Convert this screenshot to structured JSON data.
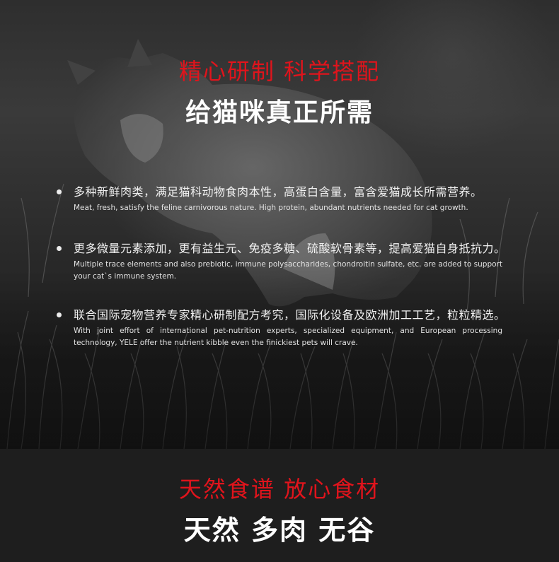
{
  "hero": {
    "headline_red": "精心研制 科学搭配",
    "headline_white": "给猫咪真正所需",
    "features": [
      {
        "zh": "多种新鲜肉类，满足猫科动物食肉本性，高蛋白含量，富含爱猫成长所需营养。",
        "en": "Meat, fresh, satisfy the feline carnivorous nature. High protein, abundant nutrients needed for cat growth."
      },
      {
        "zh": "更多微量元素添加，更有益生元、免疫多糖、硫酸软骨素等，提高爱猫自身抵抗力。",
        "en": "Multiple trace elements and also prebiotic, immune polysaccharides, chondroitin sulfate, etc. are added to support your cat`s immune system."
      },
      {
        "zh": "联合国际宠物营养专家精心研制配方考究，国际化设备及欧洲加工工艺，粒粒精选。",
        "en": "With joint effort of international pet-nutrition experts, specialized equipment, and European processing technology, YELE offer the nutrient kibble even the finickiest pets will crave."
      }
    ]
  },
  "band": {
    "headline_red": "天然食谱 放心食材",
    "headline_white": "天然 多肉 无谷"
  },
  "colors": {
    "accent_red": "#e0141c",
    "text_white": "#ffffff",
    "band_bg": "#1e1e1e"
  }
}
